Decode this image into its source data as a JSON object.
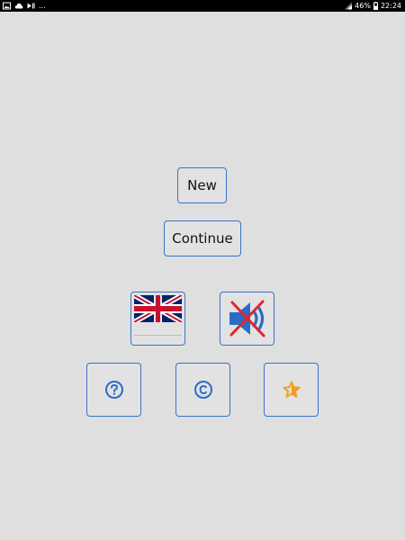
{
  "status_bar": {
    "overflow": "...",
    "battery": "46%",
    "time": "22:24",
    "left_icons": [
      "gallery-icon",
      "cloud-icon",
      "cast-icon"
    ],
    "right_icons": [
      "signal-icon",
      "battery-icon"
    ]
  },
  "menu": {
    "new_label": "New",
    "continue_label": "Continue",
    "language_flag": "uk-flag-icon",
    "sound_state": "muted"
  },
  "icon_buttons": [
    {
      "name": "help-button",
      "icon": "question-icon"
    },
    {
      "name": "copyright-button",
      "icon": "copyright-icon"
    },
    {
      "name": "rate-button",
      "icon": "star-icon"
    }
  ],
  "colors": {
    "background": "#dfdfdf",
    "button_border": "#3a73c6",
    "icon_blue": "#2a6dc7",
    "star_orange": "#f0a020",
    "mute_cross": "#e0262e"
  }
}
